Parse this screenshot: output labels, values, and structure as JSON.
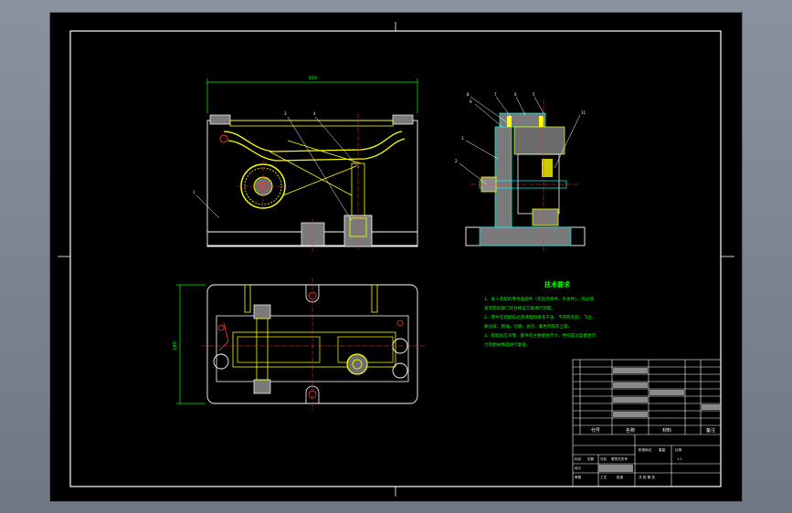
{
  "colors": {
    "background": "#000000",
    "frame": "#ffffff",
    "yellow": "#ffff00",
    "green": "#00ff00",
    "red": "#ff3030",
    "cyan": "#00ffff",
    "grey_fill": "#8a8a8a"
  },
  "drawing": {
    "dim_top_width": "300",
    "dim_left_height": "180",
    "tech_requirements": {
      "title": "技术要求",
      "lines": [
        "1、进入装配的零件及部件（包括外购件、外协件），均必须",
        "具有检验部门的合格证方能进行装配。",
        "2、零件在装配前必须清理和清洗干净，不得有毛刺、飞边、",
        "氧化皮、锈蚀、切屑、油污、着色剂和灰尘等。",
        "3、装配前应对零、部件的主要配合尺寸，特别是过盈配合尺",
        "寸及相关精度进行复查。"
      ]
    },
    "title_block": {
      "header_code": "代号",
      "header_name": "名称",
      "header_material": "材料",
      "header_remark": "备注",
      "sign_labels": [
        "标记",
        "处数",
        "分区",
        "更改文件号",
        "签名",
        "年月日"
      ],
      "approval_labels": [
        "设计",
        "审核",
        "工艺",
        "批准"
      ],
      "stage_labels": [
        "阶段标记",
        "重量",
        "比例"
      ],
      "sheet_text": "共 张 第 张",
      "scale": "1:1"
    }
  }
}
